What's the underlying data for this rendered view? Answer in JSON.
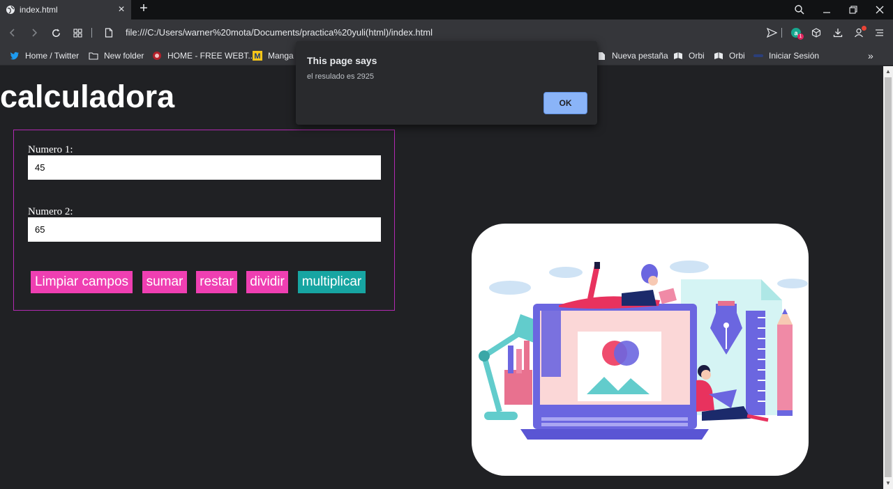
{
  "browser": {
    "tab_title": "index.html",
    "new_tab_symbol": "+",
    "url": "file:///C:/Users/warner%20mota/Documents/practica%20yuli(html)/index.html",
    "bookmarks": [
      {
        "label": "Home / Twitter",
        "icon": "twitter-icon"
      },
      {
        "label": "New folder",
        "icon": "folder-icon"
      },
      {
        "label": "HOME - FREE WEBT...",
        "icon": "site-icon"
      },
      {
        "label": "Manga",
        "icon": "manga-icon"
      },
      {
        "label": "Nueva pestaña",
        "icon": "page-icon"
      },
      {
        "label": "Orbi",
        "icon": "orbi-icon"
      },
      {
        "label": "Orbi",
        "icon": "orbi-icon"
      },
      {
        "label": "Iniciar Sesión",
        "icon": "login-icon"
      }
    ],
    "extension_badge": "1"
  },
  "page": {
    "heading": "calculadora",
    "form": {
      "label1": "Numero 1:",
      "value1": "45",
      "label2": "Numero 2:",
      "value2": "65",
      "buttons": {
        "clear": "Limpiar campos",
        "add": "sumar",
        "subtract": "restar",
        "divide": "dividir",
        "multiply": "multiplicar"
      }
    }
  },
  "dialog": {
    "title": "This page says",
    "message": "el resulado es 2925",
    "ok_label": "OK"
  },
  "colors": {
    "accent_pink": "#ef3fb2",
    "accent_teal": "#17a5a2",
    "form_border": "#b32ab3",
    "dialog_button": "#8ab4f8"
  }
}
